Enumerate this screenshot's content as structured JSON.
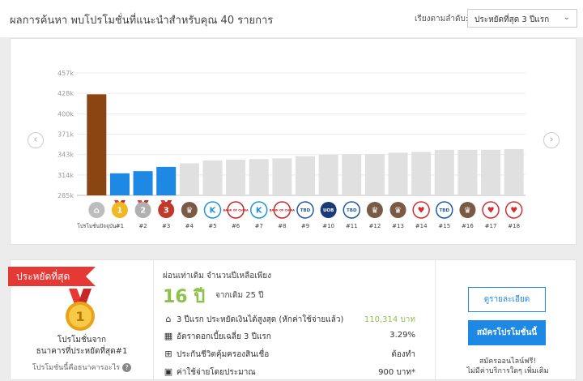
{
  "header": {
    "title": "ผลการค้นหา พบโปรโมชั่นที่แนะนำสำหรับคุณ 40 รายการ",
    "sort_label": "เรียงตามลำดับ:",
    "sort_value": "ประหยัดที่สุด 3 ปีแรก"
  },
  "chart_data": {
    "type": "bar",
    "y_ticks": [
      "285k",
      "314k",
      "343k",
      "371k",
      "400k",
      "428k",
      "457k"
    ],
    "ylim": [
      285000,
      457000
    ],
    "categories": [
      "โปรโมชั่นปัจจุบัน",
      "#1",
      "#2",
      "#3",
      "#4",
      "#5",
      "#6",
      "#7",
      "#8",
      "#9",
      "#10",
      "#11",
      "#12",
      "#13",
      "#14",
      "#15",
      "#16",
      "#17",
      "#18"
    ],
    "values": [
      427000,
      316000,
      319000,
      325000,
      330000,
      334000,
      335000,
      336000,
      337000,
      340000,
      342000,
      343000,
      343000,
      345000,
      346000,
      349000,
      349000,
      349000,
      350000
    ],
    "colors": [
      "#8b4513",
      "#1e88e5",
      "#1e88e5",
      "#1e88e5",
      "#e0e0e0",
      "#e0e0e0",
      "#e0e0e0",
      "#e0e0e0",
      "#e0e0e0",
      "#e0e0e0",
      "#e0e0e0",
      "#e0e0e0",
      "#e0e0e0",
      "#e0e0e0",
      "#e0e0e0",
      "#e0e0e0",
      "#e0e0e0",
      "#e0e0e0",
      "#e0e0e0"
    ],
    "icons": [
      "home",
      "gold",
      "silver",
      "bronze",
      "ktb",
      "kbank",
      "boc",
      "kbank",
      "boc",
      "tbd",
      "uob",
      "tbd",
      "ktb",
      "ktb",
      "gsb",
      "tbd",
      "ktb",
      "gsb",
      "gsb"
    ],
    "grid": true
  },
  "icon_colors": {
    "home": "#bdbdbd",
    "gold": "#f2b824",
    "silver": "#b0b0b0",
    "bronze": "#c0392b",
    "ktb": "#7b5a45",
    "kbank": "#1e96d8",
    "boc": "#c62828",
    "tbd": "#1e5aa8",
    "uob": "#1a3a7a",
    "gsb": "#d32f2f"
  },
  "icon_text": {
    "home": "⌂",
    "gold": "1",
    "silver": "2",
    "bronze": "3",
    "ktb": "♛",
    "kbank": "K",
    "boc": "BANK OF CHINA",
    "tbd": "TBD",
    "uob": "UOB",
    "gsb": "♥"
  },
  "nav": {
    "prev": "‹",
    "next": "›"
  },
  "best": {
    "ribbon": "ประหยัดที่สุด",
    "medal_num": "1",
    "title_line1": "โปรโมชั่นจาก",
    "title_line2": "ธนาคารที่ประหยัดที่สุด#1",
    "link": "โปรโมชั่นนี้คือธนาคารอะไร",
    "help": "?"
  },
  "details": {
    "pay_label": "ผ่อนเท่าเดิม จำนวนปีเหลือเพียง",
    "years": "16 ปี",
    "years_from": "จากเดิม 25 ปี",
    "rows": [
      {
        "label": "3 ปีแรก ประหยัดเงินได้สูงสุด (หักค่าใช้จ่ายแล้ว)",
        "value": "110,314 บาท"
      },
      {
        "label": "อัตราดอกเบี้ยเฉลี่ย 3 ปีแรก",
        "value": "3.29%"
      },
      {
        "label": "ประกันชีวิตคุ้มครองสินเชื่อ",
        "value": "ต้องทำ"
      },
      {
        "label": "ค่าใช้จ่ายโดยประมาณ",
        "value": "900 บาท*"
      }
    ]
  },
  "actions": {
    "detail_button": "ดูรายละเอียด",
    "apply_button": "สมัครโปรโมชั่นนี้",
    "note_line1": "สมัครออนไลน์ฟรี!",
    "note_line2": "ไม่มีค่าบริการใดๆ เพิ่มเติม"
  }
}
